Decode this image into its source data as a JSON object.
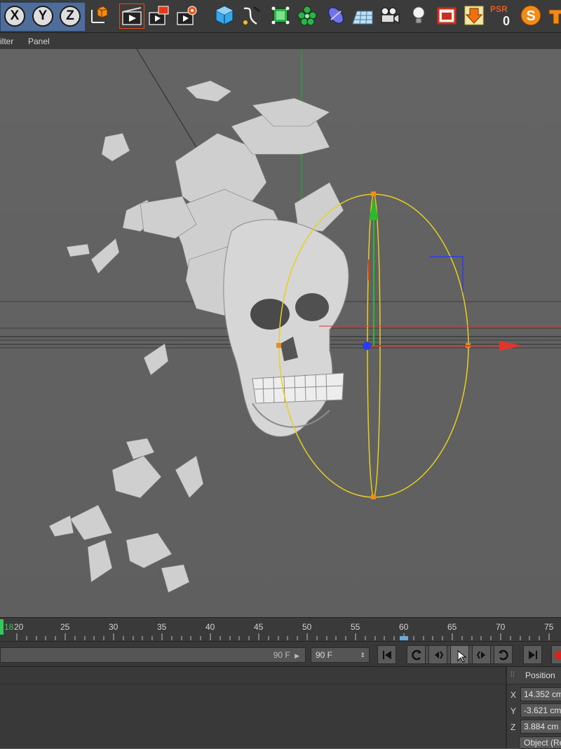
{
  "toolbar": {
    "axis_buttons": [
      "X",
      "Y",
      "Z"
    ],
    "psr_label": "PSR",
    "psr_value": "0",
    "icons": [
      "coordinate-system-icon",
      "render-view-icon",
      "render-picture-viewer-icon",
      "render-settings-icon",
      "cube-icon",
      "spline-pen-icon",
      "subdivision-icon",
      "cloner-icon",
      "deformer-icon",
      "floor-icon",
      "camera-icon",
      "light-icon",
      "layer-browser-icon",
      "download-icon",
      "sculpt-icon",
      "tag-icon"
    ]
  },
  "menubar": {
    "items": [
      "ilter",
      "Panel"
    ]
  },
  "timeline": {
    "start_marker": "18",
    "ticks": [
      "20",
      "25",
      "30",
      "35",
      "40",
      "45",
      "50",
      "55",
      "60",
      "65",
      "70",
      "75"
    ]
  },
  "transport": {
    "current_frame": "90 F",
    "end_frame": "90 F"
  },
  "attributes": {
    "header": "Position",
    "x_label": "X",
    "x_value": "14.352 cm",
    "y_label": "Y",
    "y_value": "-3.621 cm",
    "z_label": "Z",
    "z_value": "3.884 cm",
    "mode_button": "Object (Rel)"
  },
  "colors": {
    "x_axis": "#e2342a",
    "y_axis": "#2eb82e",
    "z_axis": "#2b3cf0",
    "selection": "#e6d01e",
    "accent": "#f08a18"
  }
}
